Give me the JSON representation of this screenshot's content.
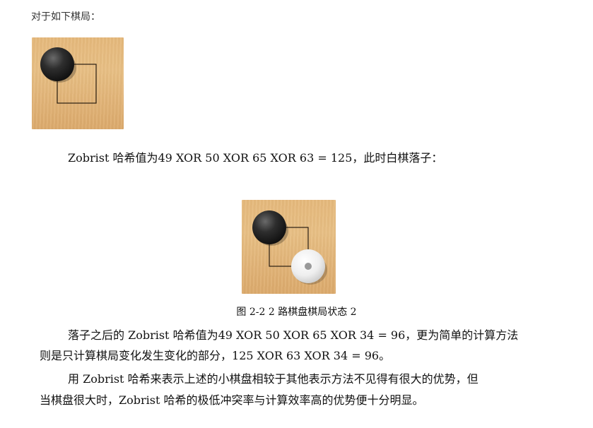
{
  "intro_text": "对于如下棋局：",
  "paragraph1": {
    "prefix": "Zobrist 哈希值为",
    "formula": "49 XOR 50 XOR 65 XOR 63 = 125",
    "suffix": "，此时白棋落子："
  },
  "figure_caption": "图 2-2 2 路棋盘棋局状态 2",
  "paragraph2": {
    "line1_prefix": "落子之后的 Zobrist 哈希值为",
    "line1_formula": "49 XOR 50 XOR 65 XOR 34 = 96",
    "line1_suffix": "，更为简单的计算方法",
    "line2_prefix": "则是只计算棋局变化发生变化的部分，",
    "line2_formula": "125 XOR 63 XOR 34 = 96",
    "line2_suffix": "。"
  },
  "paragraph3": {
    "line1": "用 Zobrist 哈希来表示上述的小棋盘相较于其他表示方法不见得有很大的优势，但",
    "line2": "当棋盘很大时，Zobrist 哈希的极低冲突率与计算效率高的优势便十分明显。"
  },
  "boards": [
    {
      "black_stone": "top-left",
      "white_stone": null
    },
    {
      "black_stone": "top-left",
      "white_stone": "bottom-right"
    }
  ]
}
